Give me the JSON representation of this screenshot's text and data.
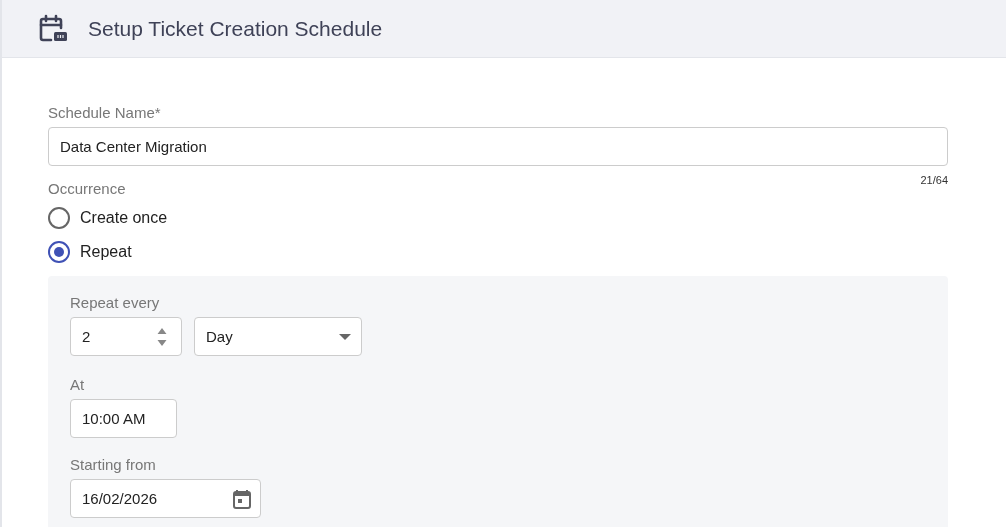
{
  "header": {
    "title": "Setup Ticket Creation Schedule"
  },
  "schedule_name": {
    "label": "Schedule Name*",
    "value": "Data Center Migration",
    "counter": "21/64"
  },
  "occurrence": {
    "label": "Occurrence",
    "options": [
      {
        "label": "Create once",
        "selected": false
      },
      {
        "label": "Repeat",
        "selected": true
      }
    ]
  },
  "repeat": {
    "label": "Repeat every",
    "interval": "2",
    "unit": "Day",
    "at_label": "At",
    "time": "10:00 AM",
    "start_label": "Starting from",
    "start_date": "16/02/2026"
  }
}
